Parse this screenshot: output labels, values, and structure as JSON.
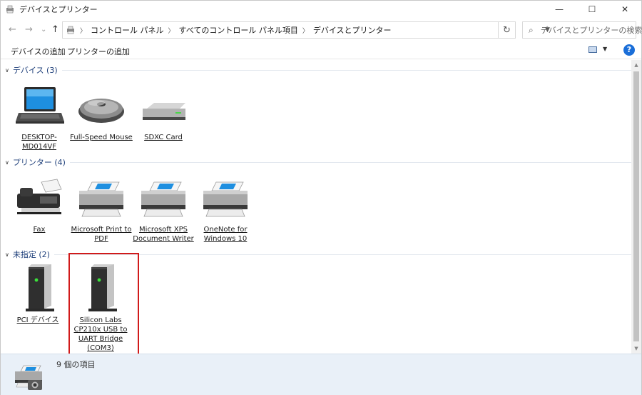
{
  "window": {
    "title": "デバイスとプリンター",
    "minimize": "—",
    "maximize": "☐",
    "close": "✕"
  },
  "nav": {
    "back": "←",
    "forward": "→",
    "recent": "⌄",
    "up": "↑",
    "breadcrumb": [
      "コントロール パネル",
      "すべてのコントロール パネル項目",
      "デバイスとプリンター"
    ],
    "refresh": "↻",
    "search_placeholder": "デバイスとプリンターの検索"
  },
  "commands": {
    "add_device": "デバイスの追加",
    "add_printer": "プリンターの追加",
    "help": "?"
  },
  "groups": [
    {
      "header": "デバイス (3)",
      "items": [
        {
          "label": "DESKTOP-MD014VF",
          "icon": "laptop-icon"
        },
        {
          "label": "Full-Speed Mouse",
          "icon": "mouse-icon"
        },
        {
          "label": "SDXC Card",
          "icon": "drive-icon"
        }
      ]
    },
    {
      "header": "プリンター (4)",
      "items": [
        {
          "label": "Fax",
          "icon": "fax-icon"
        },
        {
          "label": "Microsoft Print to PDF",
          "icon": "printer-icon"
        },
        {
          "label": "Microsoft XPS Document Writer",
          "icon": "printer-icon"
        },
        {
          "label": "OneNote for Windows 10",
          "icon": "printer-icon"
        }
      ]
    },
    {
      "header": "未指定 (2)",
      "items": [
        {
          "label": "PCI デバイス",
          "icon": "tower-device-icon"
        },
        {
          "label": "Silicon Labs CP210x USB to UART Bridge (COM3)",
          "icon": "tower-device-icon"
        }
      ]
    }
  ],
  "details": {
    "count": "9 個の項目"
  },
  "colors": {
    "group_header": "#1e3f7a",
    "highlight_border": "#d11a1a",
    "details_bg": "#e9f0f8"
  }
}
